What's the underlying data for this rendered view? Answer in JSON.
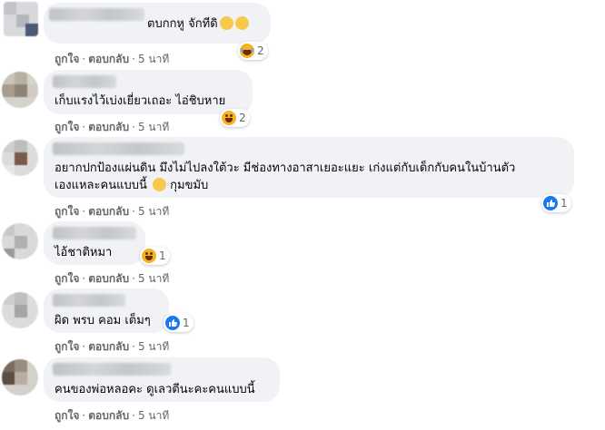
{
  "comments": [
    {
      "text": "ตบกกหู จักทีดิ",
      "emoji": "rolling-laughing-emoji",
      "actions": {
        "like": "ถูกใจ",
        "reply": "ตอบกลับ",
        "time": "5 นาที"
      },
      "reaction": {
        "icon": "laugh-icon",
        "count": "2"
      }
    },
    {
      "text": "เก็บแรงไว้เบ่งเยี่ยวเถอะ ไอ่ชิบหาย",
      "actions": {
        "like": "ถูกใจ",
        "reply": "ตอบกลับ",
        "time": "5 นาที"
      },
      "reaction": {
        "icon": "haha-icon",
        "count": "2"
      }
    },
    {
      "text_line1": "อยากปกป้องแผ่นดิน มึงไม่ไปลงใต้วะ มีช่องทางอาสาเยอะแยะ เก่งแต่กับเด็กกับคนในบ้านตัว",
      "text_line2": "เองแหละคนแบบนี้",
      "text_line2_end": "กุมขมับ",
      "emoji": "relieved-emoji",
      "actions": {
        "like": "ถูกใจ",
        "reply": "ตอบกลับ",
        "time": "5 นาที"
      },
      "reaction": {
        "icon": "like-icon",
        "count": "1"
      }
    },
    {
      "text": "ไอ้ชาติหมา",
      "actions": {
        "like": "ถูกใจ",
        "reply": "ตอบกลับ",
        "time": "5 นาที"
      },
      "reaction": {
        "icon": "haha-icon",
        "count": "1"
      }
    },
    {
      "text": "ผิด พรบ คอม เต็มๆ",
      "actions": {
        "like": "ถูกใจ",
        "reply": "ตอบกลับ",
        "time": "5 นาที"
      },
      "reaction": {
        "icon": "like-icon",
        "count": "1"
      }
    },
    {
      "text": "คนของพ่อหลอคะ ดูเลวตีนะคะคนแบบนี้",
      "actions": {
        "like": "ถูกใจ",
        "reply": "ตอบกลับ",
        "time": "5 นาที"
      }
    }
  ],
  "separator": "·",
  "colors": {
    "bubble": "#f0f2f5",
    "meta": "#65676b",
    "like_blue": "#1877f2",
    "haha_yellow": "#f7b125"
  }
}
